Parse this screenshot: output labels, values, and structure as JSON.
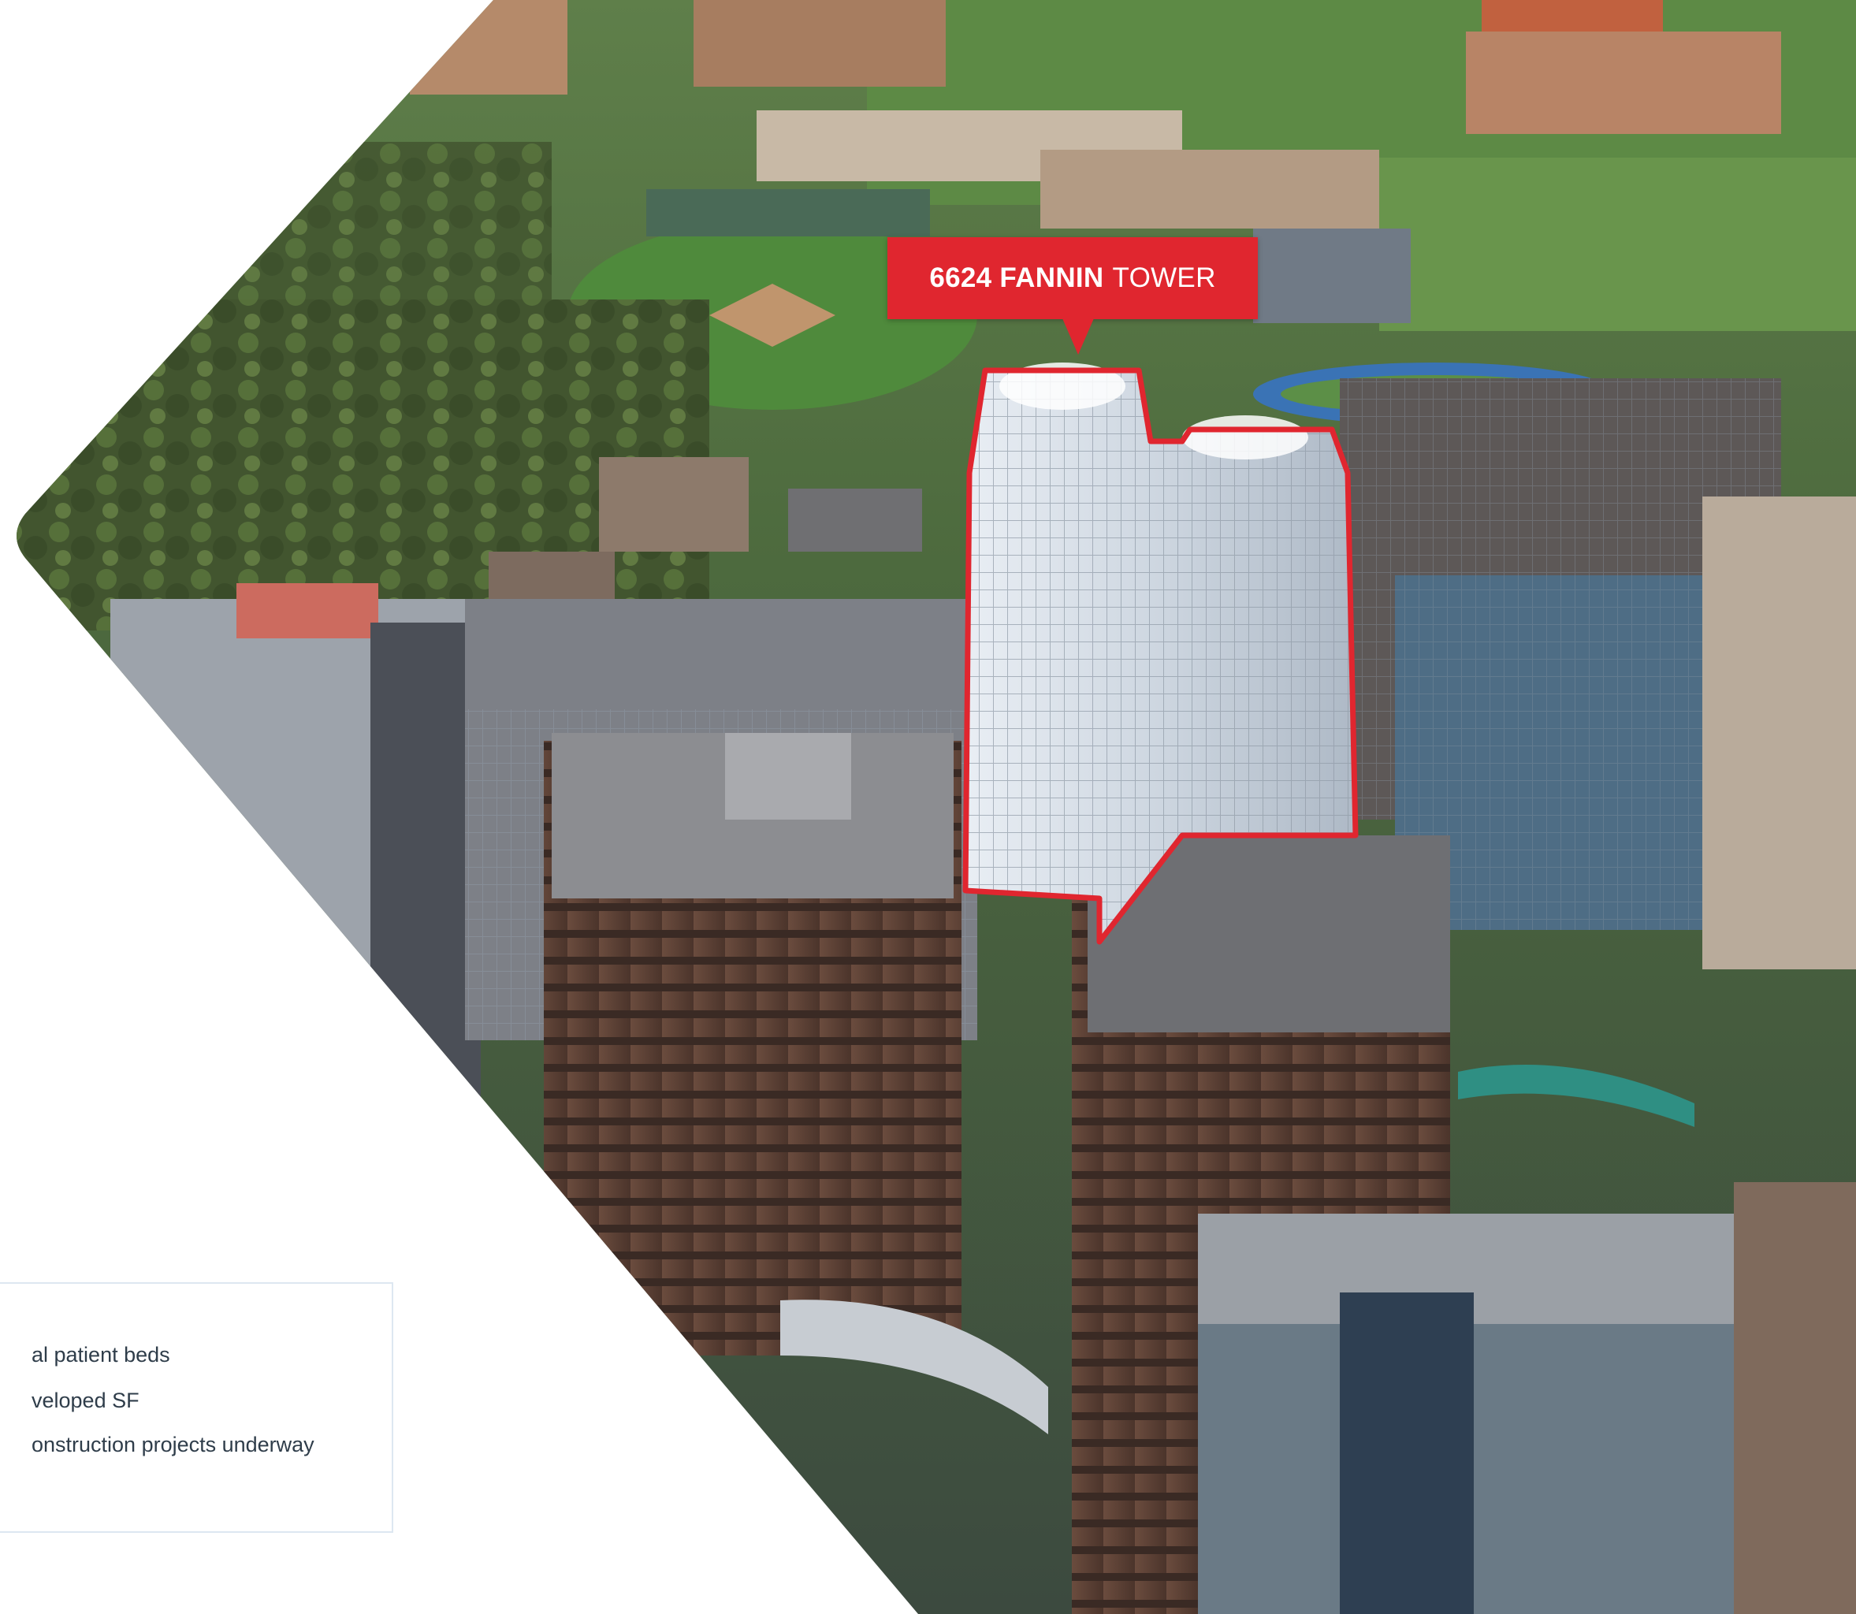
{
  "callout": {
    "name_bold": "6624 FANNIN",
    "name_light": "TOWER"
  },
  "stats": [
    {
      "text": "al patient beds"
    },
    {
      "text": "veloped SF"
    },
    {
      "text": "onstruction projects underway"
    }
  ],
  "colors": {
    "accent_red": "#e0262f",
    "card_border": "#dde7f1",
    "stat_text": "#2f3d4a"
  }
}
